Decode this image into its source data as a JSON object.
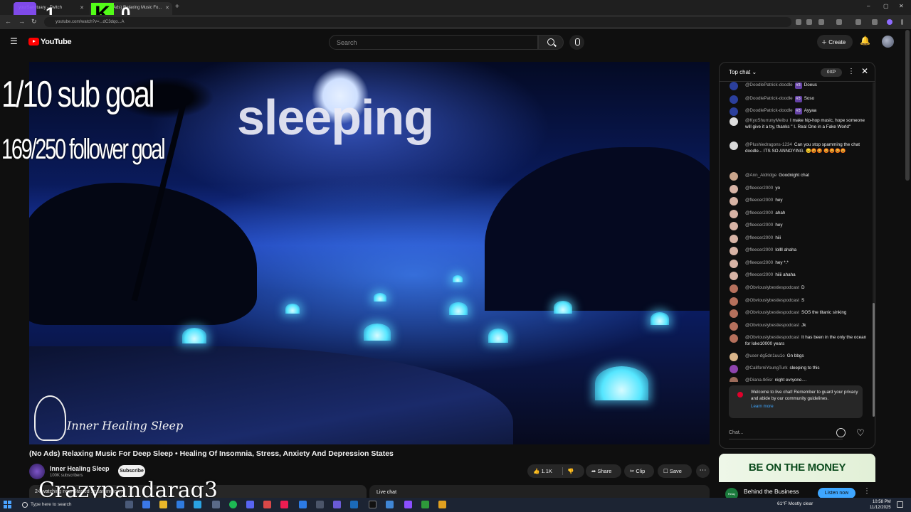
{
  "browser": {
    "tabs": [
      {
        "label": "yourSanctuary - Twitch"
      },
      {
        "label": "(No Ads) Relaxing Music Fo..."
      }
    ],
    "new_tab_label": "+",
    "url": "youtube.com/watch?v=...dC3dqo...A",
    "window_controls": {
      "minimize": "–",
      "maximize": "▢",
      "close": "✕"
    }
  },
  "header": {
    "logo_text": "YouTube",
    "search_placeholder": "Search",
    "create_label": "Create"
  },
  "stream_overlay": {
    "top_left_count": "1",
    "kick_badge": "K",
    "top_right_count": "0",
    "sub_goal": "1/10 sub goal",
    "follower_goal": "169/250 follower goal",
    "status_text": "sleeping",
    "streamer_name": "Crazypandarag3"
  },
  "video": {
    "brand_text": "Inner Healing Sleep",
    "title": "(No Ads) Relaxing Music For Deep Sleep • Healing Of Insomnia, Stress, Anxiety And Depression States",
    "channel_name": "Inner Healing Sleep",
    "channel_subs": "100K subscribers",
    "subscribe_label": "Subscribe",
    "like_count": "1.1K",
    "share_label": "Share",
    "clip_label": "Clip",
    "save_label": "Save",
    "more_label": "⋯",
    "description_preview": "24 watching now  Started streaming on ...",
    "live_chat_label": "Live chat"
  },
  "chat": {
    "header_title": "Top chat",
    "xp_badge": "0XP",
    "messages": [
      {
        "author": "@DoodlePatrick-doodle",
        "badge": "#3",
        "text": "Doeus",
        "avatar_color": "#2b3f9c"
      },
      {
        "author": "@DoodlePatrick-doodle",
        "badge": "#3",
        "text": "Soso",
        "avatar_color": "#2b3f9c"
      },
      {
        "author": "@DoodlePatrick-doodle",
        "badge": "#3",
        "text": "Ayyaa",
        "avatar_color": "#2b3f9c"
      },
      {
        "author": "@KyoShurrunyMeibu",
        "badge": "",
        "text": "I make hip-hop music, hope someone will give it a try, thanks \" I. Real One in a Fake World\"",
        "avatar_color": "#dddddd"
      },
      {
        "author": "@Plushiedragons-1234",
        "badge": "",
        "text": "Can you stop spamming the chat doodle... ITS SO ANNOYING. 😠😡😡 😡😡😡😡",
        "avatar_color": "#d8d8d8"
      },
      {
        "author": "@Ann_Aldridge",
        "badge": "",
        "text": "Goodnight chat",
        "avatar_color": "#c9a58c"
      },
      {
        "author": "@fleecer2000",
        "badge": "",
        "text": "yo",
        "avatar_color": "#d7b3a5"
      },
      {
        "author": "@fleecer2000",
        "badge": "",
        "text": "hey",
        "avatar_color": "#d7b3a5"
      },
      {
        "author": "@fleecer2000",
        "badge": "",
        "text": "ahah",
        "avatar_color": "#d7b3a5"
      },
      {
        "author": "@fleecer2000",
        "badge": "",
        "text": "hey",
        "avatar_color": "#d7b3a5"
      },
      {
        "author": "@fleecer2000",
        "badge": "",
        "text": "hiii",
        "avatar_color": "#d7b3a5"
      },
      {
        "author": "@fleecer2000",
        "badge": "",
        "text": "lollll ahaha",
        "avatar_color": "#d7b3a5"
      },
      {
        "author": "@fleecer2000",
        "badge": "",
        "text": "hey *.*",
        "avatar_color": "#d7b3a5"
      },
      {
        "author": "@fleecer2000",
        "badge": "",
        "text": "hiiii ahaha",
        "avatar_color": "#d7b3a5"
      },
      {
        "author": "@Obviouslybestiespodcast",
        "badge": "",
        "text": "D",
        "avatar_color": "#b5705c"
      },
      {
        "author": "@Obviouslybestiespodcast",
        "badge": "",
        "text": "S",
        "avatar_color": "#b5705c"
      },
      {
        "author": "@Obviouslybestiespodcast",
        "badge": "",
        "text": "SOS the titanic sinking",
        "avatar_color": "#b5705c"
      },
      {
        "author": "@Obviouslybestiespodcast",
        "badge": "",
        "text": "Jk",
        "avatar_color": "#b5705c"
      },
      {
        "author": "@Obviouslybestiespodcast",
        "badge": "",
        "text": "It has been in the only the ocean for loke10000 years",
        "avatar_color": "#b5705c"
      },
      {
        "author": "@user-dg5dn1uu1o",
        "badge": "",
        "text": "Gn bbgs",
        "avatar_color": "#d9b48a"
      },
      {
        "author": "@CaliforniYoungTurk",
        "badge": "",
        "text": "sleeping to this",
        "avatar_color": "#8e44ad"
      },
      {
        "author": "@Diana-tk5sr",
        "badge": "",
        "text": "night evryone....",
        "avatar_color": "#9c6b5a"
      }
    ],
    "welcome_text": "Welcome to live chat! Remember to guard your privacy and abide by our community guidelines.",
    "learn_more_label": "Learn more",
    "input_placeholder": "Chat..."
  },
  "ad": {
    "headline": "BE ON THE MONEY",
    "logo_text": "Relay",
    "title": "Behind the Business",
    "cta_label": "Listen now"
  },
  "taskbar": {
    "search_placeholder": "Type here to search",
    "weather": "61°F  Mostly clear",
    "time": "10:58 PM",
    "date": "11/12/2025"
  },
  "colors": {
    "brand_red": "#ff0000",
    "link_blue": "#3ea6ff",
    "twitch_purple": "#8a4fff",
    "kick_green": "#53fc18"
  }
}
